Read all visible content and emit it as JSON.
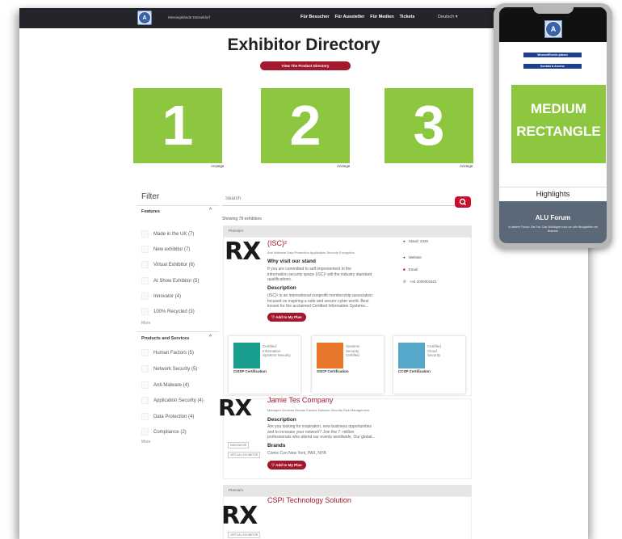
{
  "header": {
    "brand": "Messegelände Düsseldorf",
    "logo_text": "A",
    "nav": [
      "Für Besucher",
      "Für Aussteller",
      "Für Medien",
      "Tickets"
    ],
    "language": "Deutsch ▾"
  },
  "page": {
    "title": "Exhibitor Directory",
    "product_directory_button": "View The Product Directory"
  },
  "ads": [
    {
      "number": "1",
      "label": "Anzeige"
    },
    {
      "number": "2",
      "label": "Anzeige"
    },
    {
      "number": "3",
      "label": "Anzeige"
    }
  ],
  "filter": {
    "title": "Filter",
    "sections": [
      {
        "title": "Features",
        "items": [
          "Made in the UK (7)",
          "New exhibitor (7)",
          "Virtual Exhibitor (6)",
          "At Show Exhibitor (5)",
          "Innovator (4)",
          "100% Recycled (3)"
        ],
        "more": "More"
      },
      {
        "title": "Products and Services",
        "items": [
          "Human Factors (5)",
          "Network Security (5)",
          "Anti-Malware (4)",
          "Application Security (4)",
          "Data Protection (4)",
          "Compliance (2)"
        ],
        "more": "More"
      }
    ]
  },
  "search": {
    "placeholder": "Search"
  },
  "results": {
    "count": "Showing 78 exhibitors"
  },
  "exhibitors": [
    {
      "banner": "Premium",
      "name": "(ISC)²",
      "subtitle": "Anti Malware Data Protection Application Security Encryption",
      "why_title": "Why visit our stand",
      "why_text": [
        "If you are committed to self improvement in the",
        "information security space (ISC)² will the industry standard",
        "qualifications."
      ],
      "desc_title": "Description",
      "desc_text": [
        "(ISC)² is an international nonprofit membership association",
        "focused on inspiring a safe and secure cyber world. Best",
        "known for the acclaimed Certified Information Systems..."
      ],
      "add_plan": "Add to My Plan",
      "stand": "Stand: 2345",
      "website": "Website",
      "email": "Email",
      "phone": "+44 2000001621",
      "certs": [
        {
          "name": "CISSP Certification",
          "text": [
            "Certified",
            "Information",
            "Systems Security"
          ],
          "color": "#1a9e8e"
        },
        {
          "name": "SSCP Certification",
          "text": [
            "Systems",
            "Security",
            "Certified"
          ],
          "color": "#e7782b"
        },
        {
          "name": "CCSP Certification",
          "text": [
            "Certified",
            "Cloud",
            "Security"
          ],
          "color": "#55a8c9"
        }
      ]
    },
    {
      "name": "Jamie Tes Company",
      "subtitle": "Managed Services Human Factors Network Security Risk Management",
      "desc_title": "Description",
      "desc_text": [
        "Are you looking for inspiration, new business opportunities",
        "and to increase your network? Join the 7- million",
        "professionals who attend our events worldwide. Our global..."
      ],
      "brands_title": "Brands",
      "brands_text": "Comic Con New York, PAX, NYB",
      "add_plan": "Add to My Plan",
      "tags": [
        "INNOVATOR",
        "VIRTUAL EXHIBITOR"
      ]
    },
    {
      "banner": "Premium",
      "name": "CSPI Technology Solution",
      "tags": [
        "VIRTUAL EXHIBITOR"
      ]
    }
  ],
  "rx_logo": "RX",
  "phone": {
    "logo_text": "A",
    "buttons": [
      "Messen/Events planen",
      "Kontakt & Anreise"
    ],
    "ad_line1": "MEDIUM",
    "ad_line2": "RECTANGLE",
    "highlights": "Highlights",
    "forum_title": "ALU Forum",
    "forum_text": "In diesem Forum: Die Fair. Das Wichtigste rund um alle Neuigkeiten der Branche"
  }
}
